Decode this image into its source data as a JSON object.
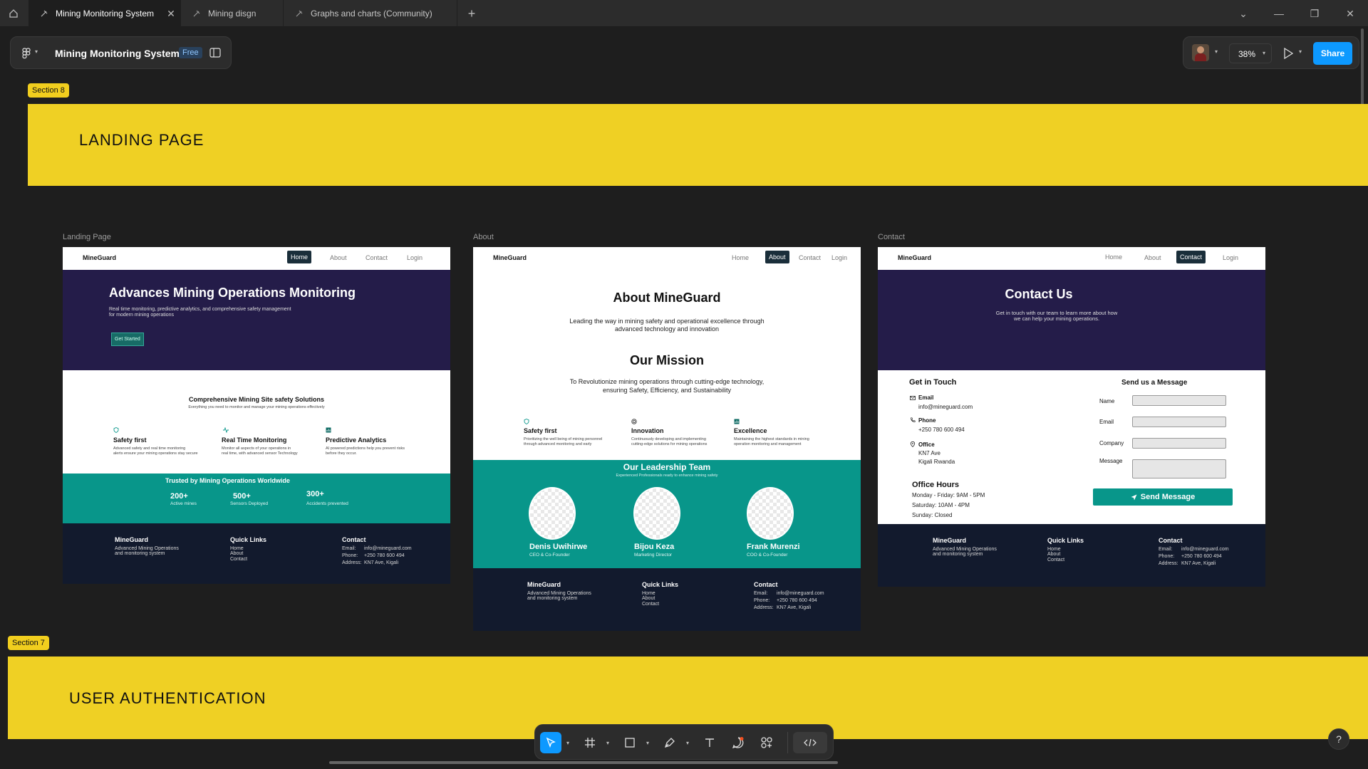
{
  "tabs": [
    {
      "label": "Mining Monitoring System",
      "active": true
    },
    {
      "label": "Mining disgn",
      "active": false
    },
    {
      "label": "Graphs and charts (Community)",
      "active": false
    }
  ],
  "file": {
    "name": "Mining Monitoring System",
    "plan": "Free"
  },
  "right": {
    "zoom": "38%",
    "share_label": "Share"
  },
  "sections": {
    "s8": {
      "label": "Section 8",
      "title": "LANDING PAGE"
    },
    "s7": {
      "label": "Section 7",
      "title": "USER AUTHENTICATION"
    }
  },
  "frames": {
    "landing": {
      "frame_label": "Landing Page",
      "brand": "MineGuard",
      "nav": [
        "Home",
        "About",
        "Contact",
        "Login"
      ],
      "hero_title": "Advances Mining Operations Monitoring",
      "hero_sub1": "Real time monitoring, predictive analytics, and  comprehensive safety management",
      "hero_sub2": "for modern mining operations",
      "cta": "Get Started",
      "solutions_title": "Comprehensive Mining Site safety Solutions",
      "solutions_sub": "Everything you need to monitor and manage your mining operations effectively",
      "features": [
        {
          "title": "Safety first",
          "d1": "Advanced safety and real time monitoring",
          "d2": "alerts ensure your mining operations stay secure"
        },
        {
          "title": "Real Time Monitoring",
          "d1": "Monitor all aspects of your operations in",
          "d2": "real time, with advanced sensor Technology"
        },
        {
          "title": "Predictive Analytics",
          "d1": "AI powered predictions help you prevent risks",
          "d2": "before they occur."
        }
      ],
      "trusted": "Trusted by Mining Operations Worldwide",
      "stats": [
        {
          "value": "200+",
          "label": "Active mines"
        },
        {
          "value": "500+",
          "label": "Sensors Deployed"
        },
        {
          "value": "300+",
          "label": "Accidents prevented"
        }
      ]
    },
    "about": {
      "frame_label": "About",
      "brand": "MineGuard",
      "nav": [
        "Home",
        "About",
        "Contact",
        "Login"
      ],
      "title": "About MineGuard",
      "sub1": "Leading the way in mining safety and operational excellence through",
      "sub2": "advanced technology and innovation",
      "mission_title": "Our Mission",
      "mission1": "To Revolutionize mining operations through cutting-edge technology,",
      "mission2": "ensuring Safety, Efficiency, and Sustainability",
      "values": [
        {
          "title": "Safety first",
          "d1": "Prioritizing the well being of mining personnel",
          "d2": "through advanced monitoring and early"
        },
        {
          "title": "Innovation",
          "d1": "Continuously developing and implementing",
          "d2": "cutting-edge solutions for mining operations"
        },
        {
          "title": "Excellence",
          "d1": "Maintaining the highest standards in mining",
          "d2": "operation monitoring and management"
        }
      ],
      "team_title": "Our Leadership Team",
      "team_sub": "Experienced Professionals ready to enhance mining safety",
      "team": [
        {
          "name": "Denis Uwihirwe",
          "role": "CEO & Co-Founder"
        },
        {
          "name": "Bijou Keza",
          "role": "Marketing  Director"
        },
        {
          "name": "Frank Murenzi",
          "role": "COO & Co-Founder"
        }
      ]
    },
    "contact": {
      "frame_label": "Contact",
      "brand": "MineGuard",
      "nav": [
        "Home",
        "About",
        "Contact",
        "Login"
      ],
      "title": "Contact Us",
      "sub1": "Get in touch with our team to learn more about how",
      "sub2": "we can help your mining operations.",
      "git": "Get in Touch",
      "email_label": "Email",
      "email_value": "info@mineguard.com",
      "phone_label": "Phone",
      "phone_value": "+250 780 600 494",
      "office_label": "Office",
      "office_1": "KN7 Ave",
      "office_2": "Kigali Rwanda",
      "hours_title": "Office Hours",
      "hours": [
        "Monday - Friday: 9AM - 5PM",
        "Saturday: 10AM - 4PM",
        "Sunday: Closed"
      ],
      "form_title": "Send us  a Message",
      "form_fields": [
        "Name",
        "Email",
        "Company",
        "Message"
      ],
      "send_label": "Send Message"
    }
  },
  "footer": {
    "brand": "MineGuard",
    "desc1": "Advanced Mining Operations",
    "desc2": "and monitoring system",
    "links_title": "Quick Links",
    "links": [
      "Home",
      "About",
      "Contact"
    ],
    "contact_title": "Contact",
    "email_k": "Email:",
    "email_v": "info@mineguard.com",
    "phone_k": "Phone:",
    "phone_v": "+250 780 600 494",
    "addr_k": "Address:",
    "addr_v": "KN7 Ave, Kigali"
  },
  "colors": {
    "accent": "#0d99ff",
    "section": "#efd024",
    "teal": "#08968a",
    "purple": "#241c49",
    "footer": "#121a2d"
  },
  "icons": [
    "home-icon",
    "figma-menu-icon",
    "panel-icon",
    "move-tool-icon",
    "frame-tool-icon",
    "rectangle-tool-icon",
    "pen-tool-icon",
    "text-tool-icon",
    "comment-icon",
    "actions-icon",
    "dev-mode-icon",
    "help-icon",
    "play-icon"
  ]
}
